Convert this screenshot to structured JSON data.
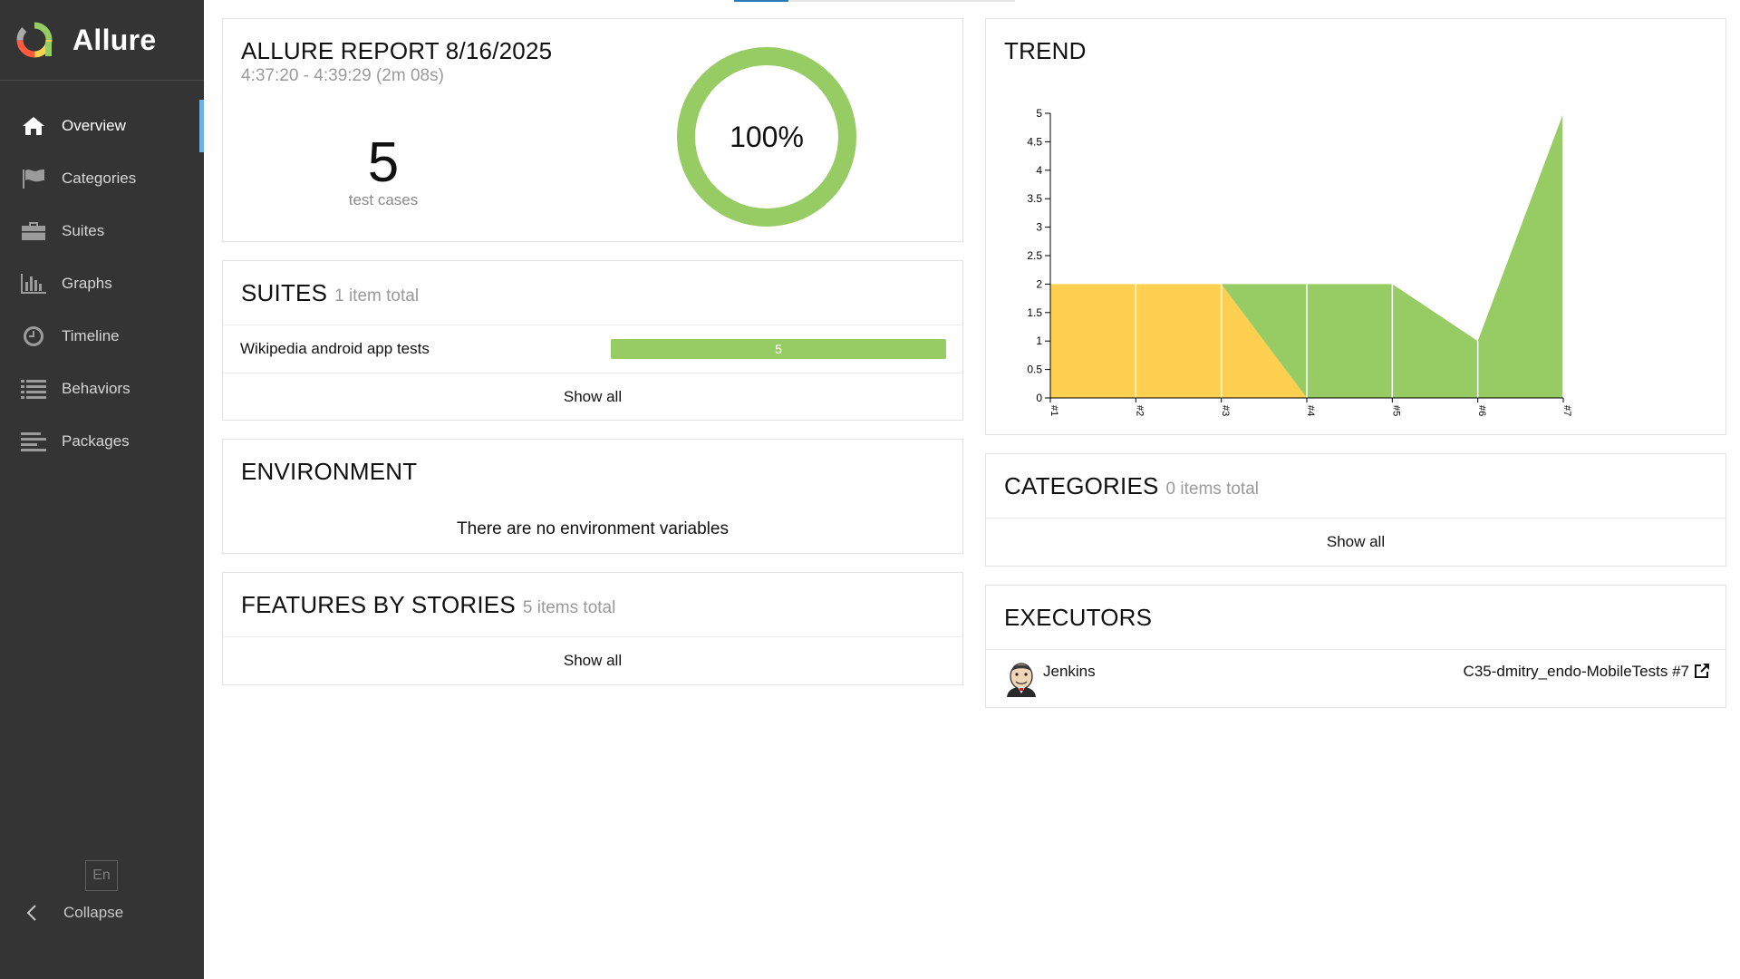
{
  "brand": {
    "name": "Allure"
  },
  "sidebar": {
    "items": [
      {
        "label": "Overview",
        "icon": "home-icon",
        "active": true
      },
      {
        "label": "Categories",
        "icon": "flag-icon",
        "active": false
      },
      {
        "label": "Suites",
        "icon": "briefcase-icon",
        "active": false
      },
      {
        "label": "Graphs",
        "icon": "bar-chart-icon",
        "active": false
      },
      {
        "label": "Timeline",
        "icon": "clock-icon",
        "active": false
      },
      {
        "label": "Behaviors",
        "icon": "list-icon",
        "active": false
      },
      {
        "label": "Packages",
        "icon": "align-left-icon",
        "active": false
      }
    ],
    "language": "En",
    "collapse_label": "Collapse"
  },
  "summary": {
    "title": "ALLURE REPORT 8/16/2025",
    "duration": "4:37:20 - 4:39:29 (2m 08s)",
    "test_count": "5",
    "test_count_label": "test cases",
    "pass_percent_label": "100%",
    "pass_fraction": 1.0,
    "color_passed": "#97cc64"
  },
  "suites": {
    "title": "SUITES",
    "subtitle": "1 item total",
    "items": [
      {
        "name": "Wikipedia android app tests",
        "passed": 5
      }
    ],
    "show_all": "Show all"
  },
  "environment": {
    "title": "ENVIRONMENT",
    "empty_text": "There are no environment variables"
  },
  "features": {
    "title": "FEATURES BY STORIES",
    "subtitle": "5 items total",
    "show_all": "Show all"
  },
  "trend": {
    "title": "TREND",
    "chart_data": {
      "type": "area",
      "x": [
        "#1",
        "#2",
        "#3",
        "#4",
        "#5",
        "#6",
        "#7"
      ],
      "y_ticks": [
        "0",
        "0.5",
        "1",
        "1.5",
        "2",
        "2.5",
        "3",
        "3.5",
        "4",
        "4.5",
        "5"
      ],
      "ylim": [
        0,
        5
      ],
      "series": [
        {
          "status": "broken",
          "color": "#ffd050",
          "values": [
            2,
            2,
            2,
            0,
            0,
            0,
            0
          ]
        },
        {
          "status": "passed",
          "color": "#97cc64",
          "values": [
            0,
            0,
            0,
            2,
            2,
            1,
            5
          ]
        }
      ]
    }
  },
  "categories": {
    "title": "CATEGORIES",
    "subtitle": "0 items total",
    "show_all": "Show all"
  },
  "executors": {
    "title": "EXECUTORS",
    "items": [
      {
        "name": "Jenkins",
        "build": "C35-dmitry_endo-MobileTests #7",
        "avatar": "jenkins-avatar-icon"
      }
    ]
  }
}
